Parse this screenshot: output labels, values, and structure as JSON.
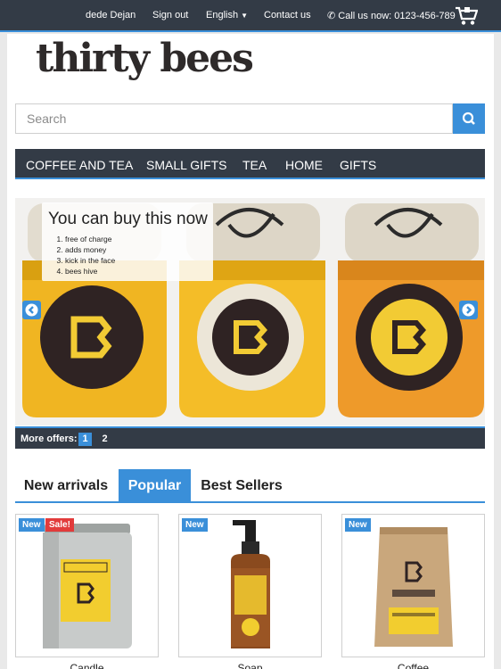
{
  "topbar": {
    "user": "dede Dejan",
    "sign_out": "Sign out",
    "language": "English",
    "contact": "Contact us",
    "call": "Call us now: 0123-456-789"
  },
  "logo": "thirty bees",
  "search": {
    "placeholder": "Search"
  },
  "menu": [
    "COFFEE AND TEA",
    "SMALL GIFTS",
    "TEA",
    "HOME",
    "GIFTS"
  ],
  "slider": {
    "caption_title": "You can buy this now",
    "caption_items": [
      "free of charge",
      "adds money",
      "kick in the face",
      "bees hive"
    ]
  },
  "more_offers": {
    "label": "More offers:",
    "pages": [
      "1",
      "2"
    ]
  },
  "tabs": [
    "New arrivals",
    "Popular",
    "Best Sellers"
  ],
  "products": [
    {
      "name": "Candle",
      "badges": [
        "New",
        "Sale!"
      ]
    },
    {
      "name": "Soap",
      "badges": [
        "New"
      ]
    },
    {
      "name": "Coffee",
      "badges": [
        "New"
      ]
    }
  ],
  "colors": {
    "accent": "#3a8fd9",
    "dark": "#333b46",
    "sale": "#e23b3b"
  }
}
